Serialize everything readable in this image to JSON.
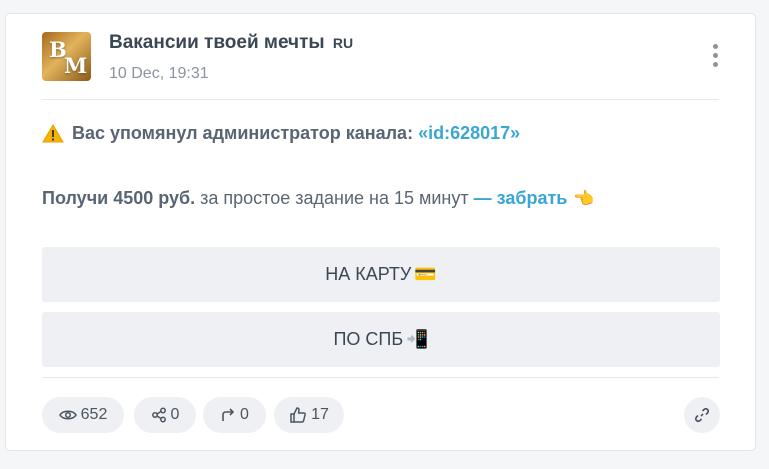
{
  "post": {
    "channel_name": "Вакансии твоей мечты",
    "channel_flag": "RU",
    "avatar_letters": [
      "В",
      "М"
    ],
    "timestamp": "10 Dec, 19:31",
    "line1_warning_icon": "⚠️",
    "line1_text": "Вас упомянул администратор канала: ",
    "line1_link": "«id:628017»",
    "line2_bold": "Получи 4500 руб.",
    "line2_text": " за простое задание на 15 минут ",
    "line2_link": "— забрать",
    "line2_emoji": "👈"
  },
  "buttons": [
    {
      "label": "НА КАРТУ",
      "icon": "💳"
    },
    {
      "label": "ПО СПБ",
      "icon": "📲"
    }
  ],
  "stats": {
    "views": "652",
    "shares": "0",
    "forwards": "0",
    "reactions": "17"
  },
  "icons": {
    "views": "eye-icon",
    "shares": "share-icon",
    "forwards": "forward-icon",
    "reactions": "thumbs-up-icon",
    "link": "link-icon",
    "menu": "more-vertical-icon"
  },
  "colors": {
    "accent_link": "#3aa6d4",
    "text": "#596573",
    "button_bg": "#eef0f3"
  }
}
